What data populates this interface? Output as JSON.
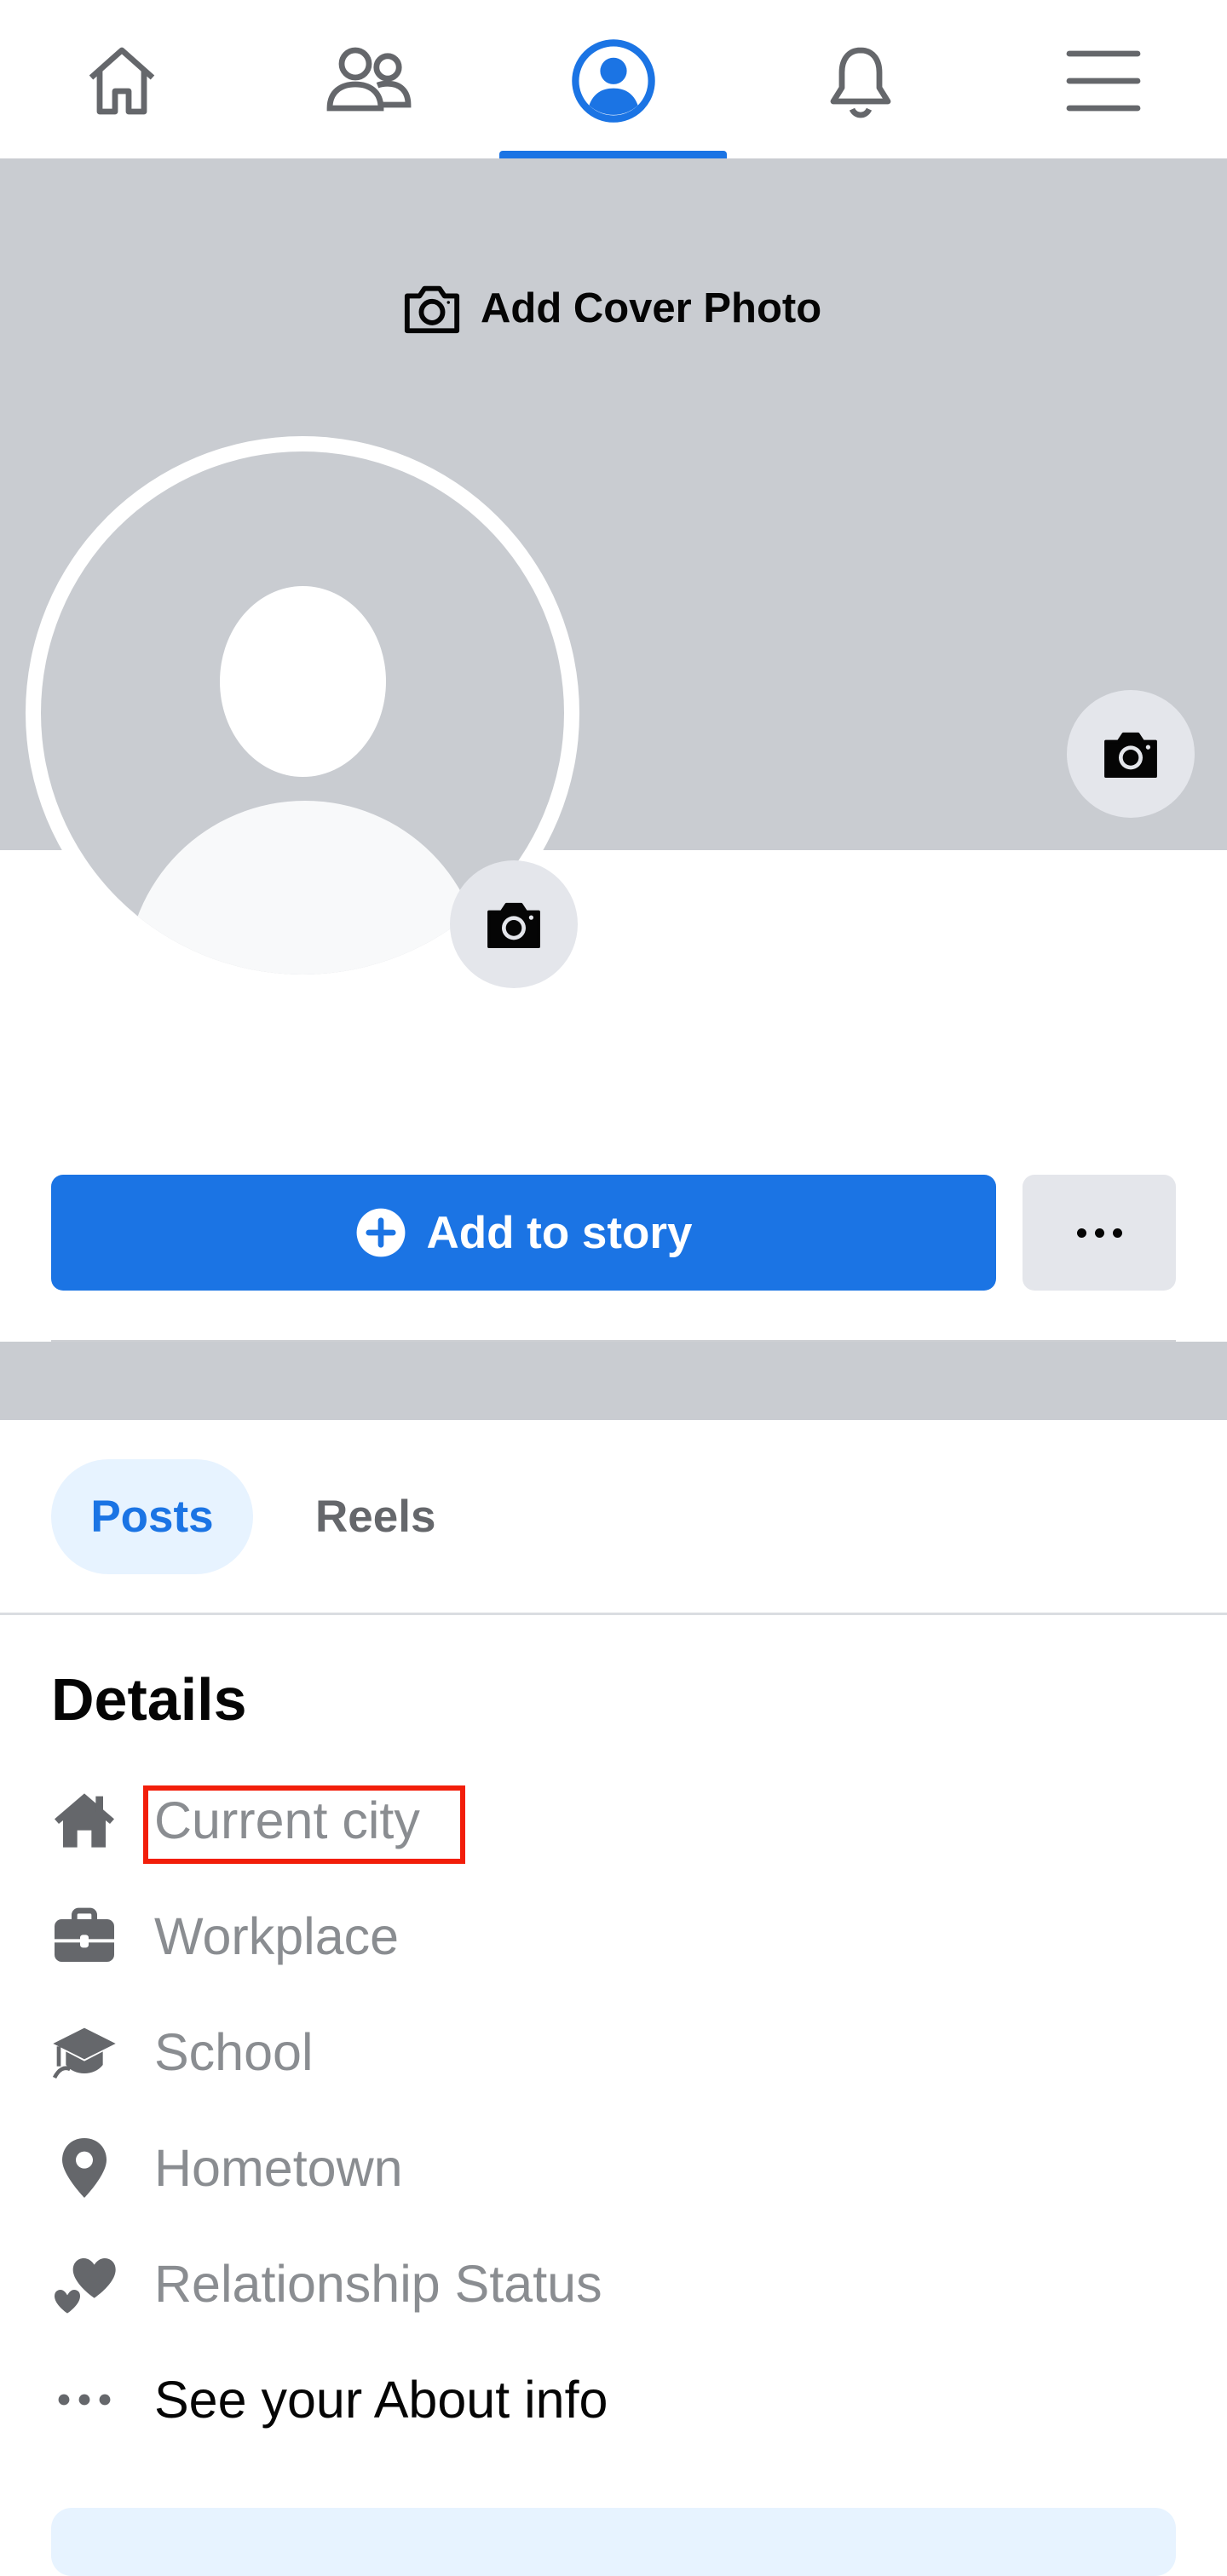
{
  "nav": {
    "tabs": [
      {
        "name": "home",
        "icon": "home-icon"
      },
      {
        "name": "friends",
        "icon": "friends-icon"
      },
      {
        "name": "profile",
        "icon": "profile-icon",
        "active": true
      },
      {
        "name": "notifications",
        "icon": "bell-icon"
      },
      {
        "name": "menu",
        "icon": "menu-icon"
      }
    ]
  },
  "cover": {
    "add_label": "Add Cover Photo"
  },
  "actions": {
    "story_label": "Add to story"
  },
  "tabs": {
    "posts": "Posts",
    "reels": "Reels"
  },
  "details": {
    "title": "Details",
    "items": [
      {
        "icon": "house-icon",
        "label": "Current city"
      },
      {
        "icon": "briefcase-icon",
        "label": "Workplace"
      },
      {
        "icon": "graduation-cap-icon",
        "label": "School"
      },
      {
        "icon": "location-pin-icon",
        "label": "Hometown"
      },
      {
        "icon": "hearts-icon",
        "label": "Relationship Status"
      },
      {
        "icon": "more-dots-icon",
        "label": "See your About info"
      }
    ]
  },
  "colors": {
    "accent": "#1b74e4",
    "cover_gray": "#c9ccd1",
    "highlight": "#f21e0a",
    "muted_text": "#8a8d91"
  }
}
